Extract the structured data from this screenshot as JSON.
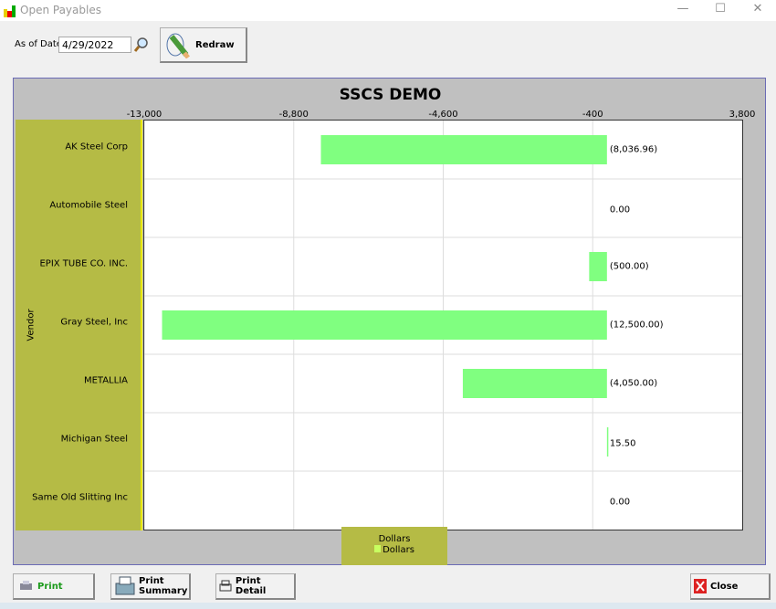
{
  "window": {
    "title": "Open Payables",
    "icon": "bar-chart-icon"
  },
  "toolbar": {
    "as_of_label": "As of Date:",
    "as_of_value": "4/29/2022",
    "redraw_label": "Redraw"
  },
  "chart_data": {
    "type": "bar",
    "orientation": "horizontal",
    "title": "SSCS DEMO",
    "ylabel": "Vendor",
    "xlabel": "Dollars",
    "categories": [
      "AK Steel Corp",
      "Automobile Steel",
      "EPIX TUBE CO. INC.",
      "Gray Steel, Inc",
      "METALLIA",
      "Michigan Steel",
      "Same Old Slitting Inc"
    ],
    "series": [
      {
        "name": "Dollars",
        "values": [
          -8036.96,
          0,
          -500,
          -12500,
          -4050,
          15.5,
          0
        ],
        "color": "#80ff80"
      }
    ],
    "data_labels": [
      "(8,036.96)",
      "0.00",
      "(500.00)",
      "(12,500.00)",
      "(4,050.00)",
      "15.50",
      "0.00"
    ],
    "xlim": [
      -13000,
      3800
    ],
    "ticks": [
      -13000,
      -8800,
      -4600,
      -400,
      3800
    ],
    "tick_labels": [
      "-13,000",
      "-8,800",
      "-4,600",
      "-400",
      "3,800"
    ],
    "grid": true,
    "legend": "bottom"
  },
  "footer": {
    "print": "Print",
    "print_summary_1": "Print",
    "print_summary_2": "Summary",
    "print_detail": "Print Detail",
    "close": "Close"
  }
}
